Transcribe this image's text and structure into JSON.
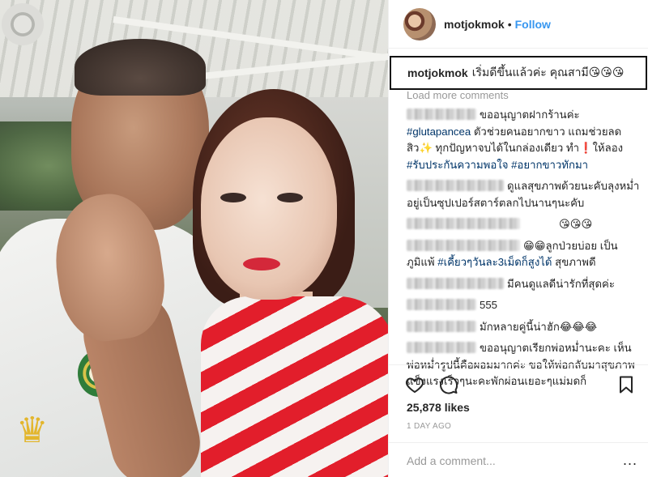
{
  "post": {
    "username": "motjokmok",
    "follow_label": "Follow",
    "dot": "•",
    "caption": "เริ่มดีขึ้นแล้วค่ะ คุณสามี😘😘😘",
    "load_more": "Load more comments"
  },
  "comments": [
    {
      "text": "ขออนุญาตฝากร้านค่ะ",
      "tag1": "#glutapancea",
      "text2": " ตัวช่วยคนอยากขาว แถมช่วยลดสิว✨ ทุกปัญหาจบได้ในกล่องเดียว ทำ❗ให้ลอง ",
      "tag2": "#รับประกันความพอใจ #อยากขาวทักมา"
    },
    {
      "text": "ดูแลสุขภาพด้วยนะคับลุงหม่ำอยู่เป็นซุปเปอร์สตาร์ตลกไปนานๆนะคับ"
    },
    {
      "text": "😘😘😘"
    },
    {
      "text": "😁😁ลูกป่วยบ่อย เป็นภูมิแพ้ ",
      "tag": "#เคี้ยวๆวันละ3เม็ดก็สูงได้",
      "text2": " สุขภาพดี"
    },
    {
      "text": "มีคนดูแลดีน่ารักที่สุดค่ะ"
    },
    {
      "text": "555"
    },
    {
      "text": "มักหลายคู่นี้น่าฮัก😂😂😂"
    },
    {
      "text": "ขออนุญาตเรียกพ่อหม่ำนะคะ เห็นพ่อหม่ำรูปนี้คือผอมมากค่ะ ขอให้พ่อกลับมาสุขภาพแข็งแรงเร็วๆนะคะพักผ่อนเยอะๆแม่มดก็"
    }
  ],
  "stats": {
    "likes": "25,878 likes",
    "time": "1 DAY AGO"
  },
  "composer": {
    "placeholder": "Add a comment...",
    "more": "..."
  },
  "icons": {
    "like": "heart-icon",
    "comment": "comment-icon",
    "save": "bookmark-icon"
  },
  "colors": {
    "link": "#3897f0",
    "hashtag": "#003569",
    "border": "#efefef"
  }
}
